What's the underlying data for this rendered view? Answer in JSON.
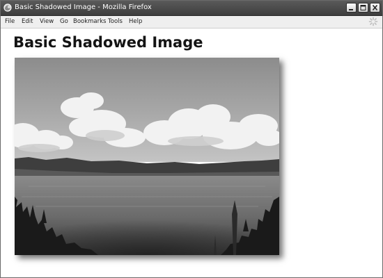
{
  "window": {
    "title": "Basic Shadowed Image - Mozilla Firefox",
    "controls": [
      "minimize-icon",
      "maximize-icon",
      "close-icon"
    ]
  },
  "menu": {
    "items": [
      "File",
      "Edit",
      "View",
      "Go",
      "Bookmarks",
      "Tools",
      "Help"
    ]
  },
  "page": {
    "heading": "Basic Shadowed Image",
    "image": {
      "subject": "landscape-photo",
      "effect": "drop-shadow"
    }
  }
}
